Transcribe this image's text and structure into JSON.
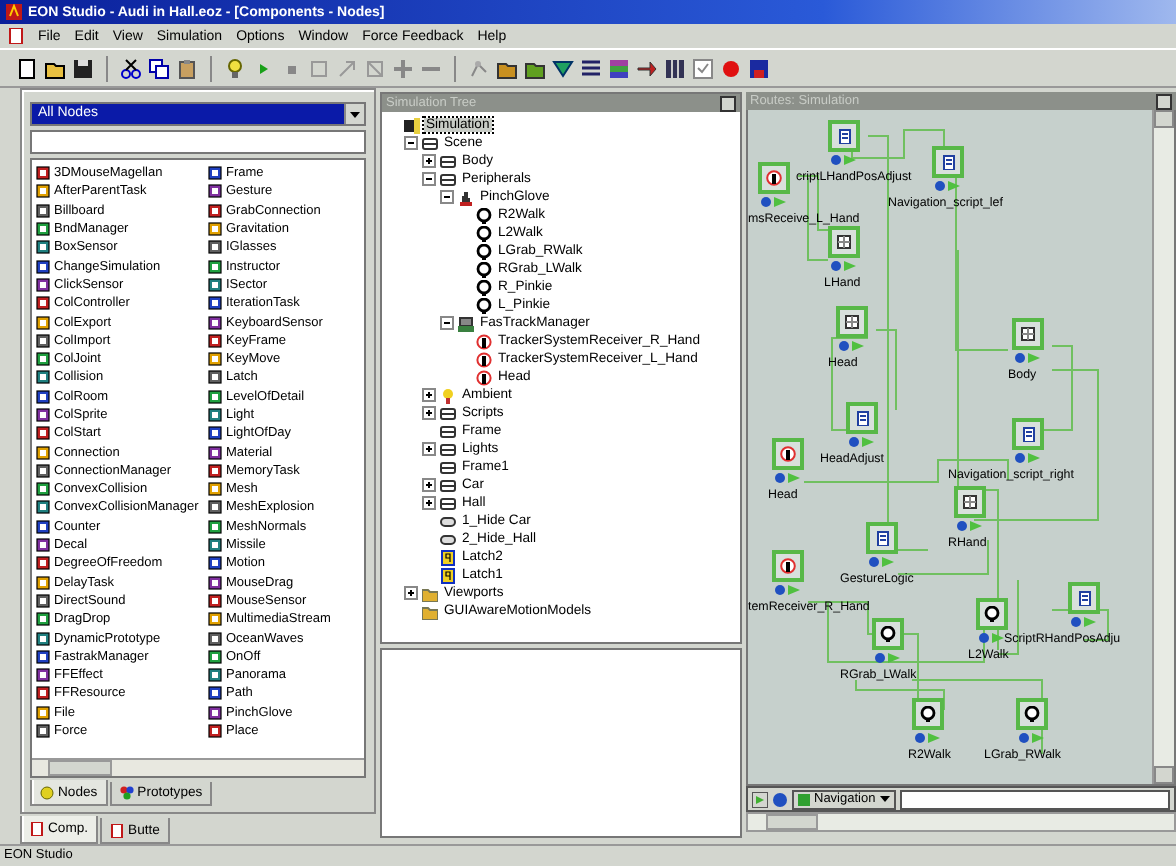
{
  "window": {
    "title": "EON Studio - Audi in Hall.eoz - [Components - Nodes]"
  },
  "menu": [
    "File",
    "Edit",
    "View",
    "Simulation",
    "Options",
    "Window",
    "Force Feedback",
    "Help"
  ],
  "palette": {
    "filter": "All Nodes",
    "columns": [
      {
        "items": [
          "3DMouseMagellan",
          "AfterParentTask",
          "Billboard",
          "BndManager",
          "BoxSensor",
          "ChangeSimulation",
          "ClickSensor",
          "ColController",
          "ColExport",
          "ColImport",
          "ColJoint",
          "Collision",
          "ColRoom",
          "ColSprite",
          "ColStart",
          "Connection",
          "ConnectionManager",
          "ConvexCollision",
          "ConvexCollisionManager",
          "Counter",
          "Decal",
          "DegreeOfFreedom",
          "DelayTask",
          "DirectSound",
          "DragDrop",
          "DynamicPrototype",
          "FastrakManager",
          "FFEffect",
          "FFResource",
          "File",
          "Force"
        ]
      },
      {
        "items": [
          "Frame",
          "Gesture",
          "GrabConnection",
          "Gravitation",
          "IGlasses",
          "Instructor",
          "ISector",
          "IterationTask",
          "KeyboardSensor",
          "KeyFrame",
          "KeyMove",
          "Latch",
          "LevelOfDetail",
          "Light",
          "LightOfDay",
          "Material",
          "MemoryTask",
          "Mesh",
          "MeshExplosion",
          "MeshNormals",
          "Missile",
          "Motion",
          "MouseDrag",
          "MouseSensor",
          "MultimediaStream",
          "OceanWaves",
          "OnOff",
          "Panorama",
          "Path",
          "PinchGlove",
          "Place"
        ]
      }
    ],
    "tabs": [
      {
        "label": "Nodes",
        "selected": true
      },
      {
        "label": "Prototypes",
        "selected": false
      }
    ]
  },
  "window_tabs": [
    {
      "label": "Comp.",
      "selected": true
    },
    {
      "label": "Butte",
      "selected": false
    }
  ],
  "tree": {
    "title": "Simulation Tree",
    "items": [
      {
        "label": "Simulation",
        "kind": "simulation",
        "selected": true,
        "children": [
          {
            "label": "Scene",
            "kind": "frame",
            "expanded": true,
            "selected": false,
            "children": [
              {
                "label": "Body",
                "kind": "frame",
                "expanded": false,
                "selected": false
              },
              {
                "label": "Peripherals",
                "kind": "frame",
                "expanded": true,
                "selected": false,
                "children": [
                  {
                    "label": "PinchGlove",
                    "kind": "glove",
                    "expanded": true,
                    "selected": false,
                    "children": [
                      {
                        "label": "R2Walk",
                        "kind": "sensor",
                        "selected": false
                      },
                      {
                        "label": "L2Walk",
                        "kind": "sensor",
                        "selected": false
                      },
                      {
                        "label": "LGrab_RWalk",
                        "kind": "sensor",
                        "selected": false
                      },
                      {
                        "label": "RGrab_LWalk",
                        "kind": "sensor",
                        "selected": false
                      },
                      {
                        "label": "R_Pinkie",
                        "kind": "sensor",
                        "selected": false
                      },
                      {
                        "label": "L_Pinkie",
                        "kind": "sensor",
                        "selected": false
                      }
                    ]
                  },
                  {
                    "label": "FasTrackManager",
                    "kind": "tracker",
                    "expanded": true,
                    "selected": false,
                    "children": [
                      {
                        "label": "TrackerSystemReceiver_R_Hand",
                        "kind": "receiver",
                        "selected": false
                      },
                      {
                        "label": "TrackerSystemReceiver_L_Hand",
                        "kind": "receiver",
                        "selected": false
                      },
                      {
                        "label": "Head",
                        "kind": "receiver",
                        "selected": false
                      }
                    ]
                  }
                ]
              },
              {
                "label": "Ambient",
                "kind": "light",
                "expanded": false,
                "selected": false
              },
              {
                "label": "Scripts",
                "kind": "frame",
                "expanded": false,
                "selected": false
              },
              {
                "label": "Frame",
                "kind": "frame",
                "selected": false
              },
              {
                "label": "Lights",
                "kind": "frame",
                "expanded": false,
                "selected": false
              },
              {
                "label": "Frame1",
                "kind": "frame",
                "selected": false
              },
              {
                "label": "Car",
                "kind": "frame",
                "expanded": false,
                "selected": false
              },
              {
                "label": "Hall",
                "kind": "frame",
                "expanded": false,
                "selected": false
              },
              {
                "label": "1_Hide Car",
                "kind": "switch",
                "selected": false
              },
              {
                "label": "2_Hide_Hall",
                "kind": "switch",
                "selected": false
              },
              {
                "label": "Latch2",
                "kind": "latch",
                "selected": false
              },
              {
                "label": "Latch1",
                "kind": "latch",
                "selected": false
              }
            ]
          },
          {
            "label": "Viewports",
            "kind": "folder",
            "expanded": false,
            "selected": false
          },
          {
            "label": "GUIAwareMotionModels",
            "kind": "folder",
            "selected": false
          }
        ]
      }
    ]
  },
  "routes": {
    "title": "Routes: Simulation",
    "nodes": [
      {
        "label": "criptLHandPosAdjust",
        "kind": "script"
      },
      {
        "label": "msReceive_L_Hand",
        "kind": "receiver"
      },
      {
        "label": "Navigation_script_lef",
        "kind": "script"
      },
      {
        "label": "LHand",
        "kind": "frame"
      },
      {
        "label": "Head",
        "kind": "frame"
      },
      {
        "label": "Body",
        "kind": "frame"
      },
      {
        "label": "HeadAdjust",
        "kind": "script"
      },
      {
        "label": "Head",
        "kind": "receiver"
      },
      {
        "label": "Navigation_script_right",
        "kind": "script"
      },
      {
        "label": "RHand",
        "kind": "frame"
      },
      {
        "label": "GestureLogic",
        "kind": "script"
      },
      {
        "label": "temReceiver_R_Hand",
        "kind": "receiver"
      },
      {
        "label": "ScriptRHandPosAdju",
        "kind": "script"
      },
      {
        "label": "L2Walk",
        "kind": "sensor"
      },
      {
        "label": "RGrab_LWalk",
        "kind": "sensor"
      },
      {
        "label": "R2Walk",
        "kind": "sensor"
      },
      {
        "label": "LGrab_RWalk",
        "kind": "sensor"
      }
    ],
    "dropdown": "Navigation"
  },
  "status_bar": "EON Studio"
}
